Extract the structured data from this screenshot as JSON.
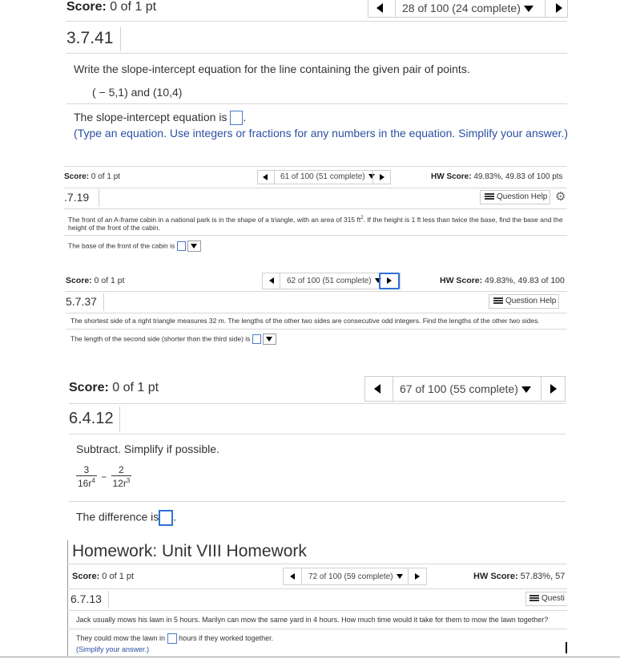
{
  "s1": {
    "score": "Score:",
    "score_val": " 0 of 1 pt",
    "progress": "28 of 100 (24 complete)",
    "qnum": "3.7.41",
    "instr": "Write the slope-intercept equation for the line containing the given pair of points.",
    "points": "( − 5,1) and (10,4)",
    "answer_prefix": "The slope-intercept equation is",
    "answer_suffix": ".",
    "hint": "(Type an equation. Use integers or fractions for any numbers in the equation. Simplify your answer.)"
  },
  "s2": {
    "score": "Score:",
    "score_val": " 0 of 1 pt",
    "progress": "61 of 100 (51 complete)",
    "hw_label": "HW Score:",
    "hw_val": " 49.83%, 49.83 of 100 pts",
    "qnum": ".7.19",
    "help": "Question Help",
    "problem_a": "The front of an A-frame cabin in a national park is in the shape of a triangle, with an area of 315 ft",
    "problem_sup": "2",
    "problem_b": ". If the height is 1 ft less than twice the base, find the base and the height of the front of the cabin.",
    "answer_prefix": "The base of the front of the cabin is"
  },
  "s3": {
    "score": "Score:",
    "score_val": " 0 of 1 pt",
    "progress": "62 of 100 (51 complete)",
    "hw_label": "HW Score:",
    "hw_val": " 49.83%, 49.83 of 100",
    "qnum": "5.7.37",
    "help": "Question Help",
    "problem": "The shortest side of a right triangle measures 32 m. The lengths of the other two sides are consecutive odd integers. Find the lengths of the other two sides.",
    "answer_prefix": "The length of the second side (shorter than the third side) is"
  },
  "s4": {
    "score": "Score:",
    "score_val": " 0 of 1 pt",
    "progress": "67 of 100 (55 complete)",
    "qnum": "6.4.12",
    "instr": "Subtract. Simplify if possible.",
    "frac1_num": "3",
    "frac1_den": "16r",
    "frac1_exp": "4",
    "minus": "−",
    "frac2_num": "2",
    "frac2_den": "12r",
    "frac2_exp": "3",
    "answer_prefix": "The difference is",
    "answer_suffix": "."
  },
  "s5": {
    "title": "Homework: Unit VIII Homework",
    "score": "Score:",
    "score_val": " 0 of 1 pt",
    "progress": "72 of 100 (59 complete)",
    "hw_label": "HW Score:",
    "hw_val": " 57.83%, 57",
    "qnum": "6.7.13",
    "help": "Questi",
    "problem": "Jack usually mows his lawn in 5 hours. Marilyn can mow the same yard in 4 hours.  How much time would it take for them to mow the lawn together?",
    "answer_prefix": "They could mow the lawn in",
    "answer_suffix": "hours if they worked together.",
    "hint": "(Simplify your answer.)"
  }
}
